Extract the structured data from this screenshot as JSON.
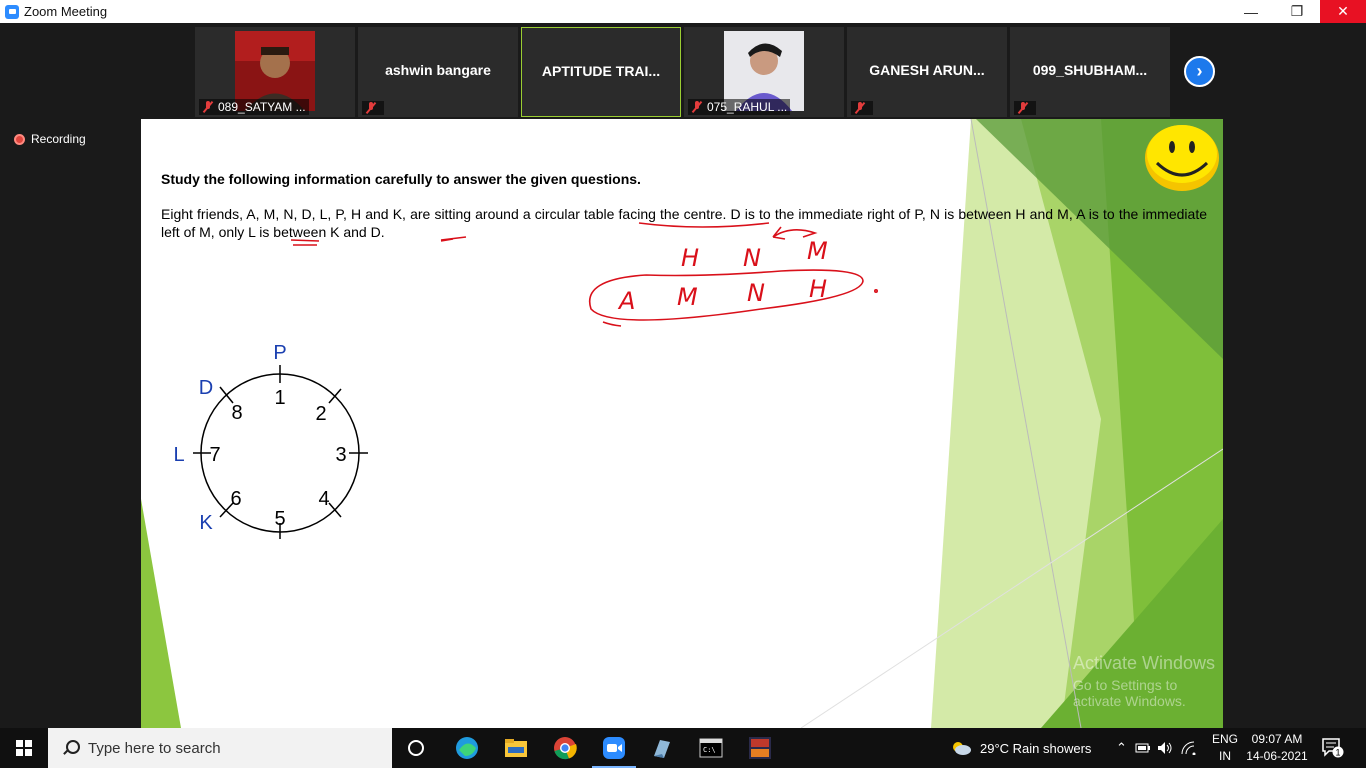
{
  "window": {
    "title": "Zoom Meeting"
  },
  "participants": {
    "tiles": [
      {
        "label": "089_SATYAM ..."
      },
      {
        "name": "ashwin bangare"
      },
      {
        "name": "APTITUDE TRAI..."
      },
      {
        "label": "075_RAHUL ..."
      },
      {
        "name": "GANESH ARUN..."
      },
      {
        "name": "099_SHUBHAM..."
      }
    ]
  },
  "recording": {
    "label": "Recording"
  },
  "slide": {
    "heading": "Study the following information carefully to answer the given questions.",
    "paragraph": "Eight friends, A, M, N, D, L, P, H and K, are sitting around a circular table facing the centre. D is to the immediate right of P, N is between H and M, A is to the immediate left of M, only L is between K and D.",
    "diagram": {
      "top_label": "P",
      "left_labels": [
        "D",
        "L",
        "K"
      ],
      "positions": [
        "1",
        "2",
        "3",
        "4",
        "5",
        "6",
        "7",
        "8"
      ]
    },
    "handwriting": {
      "row1": [
        "H",
        "N",
        "M"
      ],
      "row2": [
        "A",
        "M",
        "N",
        "H"
      ]
    }
  },
  "watermark": {
    "line1": "Activate Windows",
    "line2": "Go to Settings to activate Windows."
  },
  "taskbar": {
    "search_placeholder": "Type here to search",
    "weather": "29°C  Rain showers",
    "lang_top": "ENG",
    "lang_bottom": "IN",
    "time": "09:07 AM",
    "date": "14-06-2021",
    "notification_count": "1"
  },
  "colors": {
    "accent_green": "#9acd32",
    "annotation_red": "#d9101a",
    "diagram_blue": "#1a3fb0"
  }
}
